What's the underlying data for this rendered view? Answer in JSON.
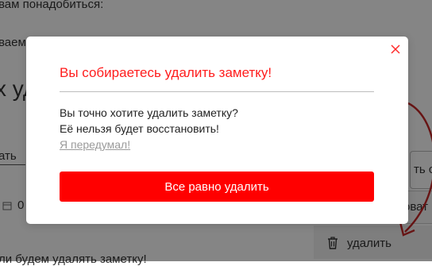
{
  "background": {
    "line_top": "вам понадобиться:",
    "line_second": "ваем",
    "big_text": "х удал",
    "side_left_text": "ать",
    "side_right_text": "ть с",
    "date_prefix": "0",
    "side_right_text2": "оват",
    "delete_label": "удалить",
    "bottom_text": "ли будем удалять заметку!"
  },
  "modal": {
    "title": "Вы собираетесь удалить заметку!",
    "line1": "Вы точно хотите удалить заметку?",
    "line2": "Её нельзя будет восстановить!",
    "cancel_label": "Я передумал!",
    "confirm_label": "Все равно удалить"
  },
  "colors": {
    "accent": "#ff0000",
    "title": "#ff1d1d",
    "overlay": "rgba(0,0,0,0.48)"
  }
}
